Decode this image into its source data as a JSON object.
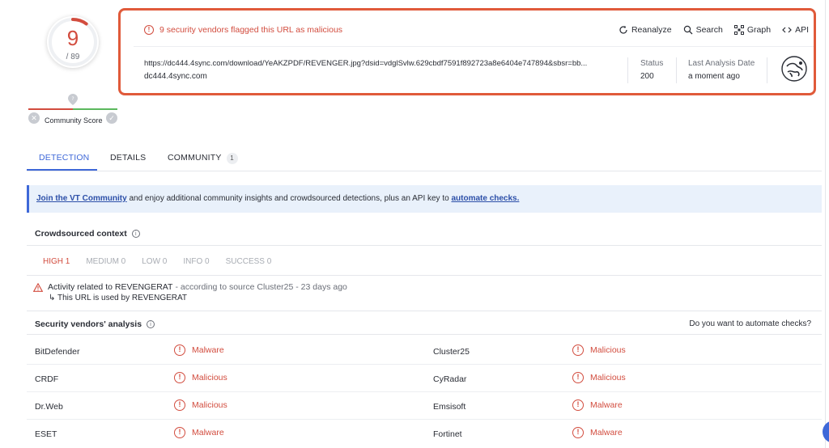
{
  "score": {
    "detections": "9",
    "total": "/ 89",
    "ring_color": "#d24c3e",
    "fraction": 0.101
  },
  "community_score": {
    "label": "Community Score",
    "x_icon": "x-icon",
    "check_icon": "check-icon",
    "pin_icon": "location-pin-icon"
  },
  "header": {
    "flag_text": "9 security vendors flagged this URL as malicious",
    "actions": [
      {
        "label": "Reanalyze",
        "icon": "refresh-icon"
      },
      {
        "label": "Search",
        "icon": "search-icon"
      },
      {
        "label": "Graph",
        "icon": "graph-icon"
      },
      {
        "label": "API",
        "icon": "code-icon"
      }
    ],
    "url": "https://dc444.4sync.com/download/YeAKZPDF/REVENGER.jpg?dsid=vdglSvlw.629cbdf7591f892723a8e6404e747894&sbsr=bb...",
    "domain": "dc444.4sync.com",
    "status_label": "Status",
    "status_value": "200",
    "last_label": "Last Analysis Date",
    "last_value": "a moment ago",
    "highlight_color": "#e05a3a"
  },
  "tabs": [
    {
      "label": "DETECTION",
      "active": true
    },
    {
      "label": "DETAILS",
      "active": false
    },
    {
      "label": "COMMUNITY",
      "badge": "1",
      "active": false
    }
  ],
  "banner": {
    "link1": "Join the VT Community",
    "middle": " and enjoy additional community insights and crowdsourced detections, plus an API key to ",
    "link2": "automate checks."
  },
  "crowdsourced": {
    "title": "Crowdsourced context",
    "severity_tabs": [
      "HIGH 1",
      "MEDIUM 0",
      "LOW 0",
      "INFO 0",
      "SUCCESS 0"
    ],
    "activity_title": "Activity related to REVENGERAT",
    "activity_source": "- according to source Cluster25 - 23 days ago",
    "activity_sub": "↳ This URL is used by REVENGERAT"
  },
  "vendors": {
    "title": "Security vendors' analysis",
    "automate_question": "Do you want to automate checks?",
    "rows": [
      {
        "left_name": "BitDefender",
        "left_verdict": "Malware",
        "right_name": "Cluster25",
        "right_verdict": "Malicious"
      },
      {
        "left_name": "CRDF",
        "left_verdict": "Malicious",
        "right_name": "CyRadar",
        "right_verdict": "Malicious"
      },
      {
        "left_name": "Dr.Web",
        "left_verdict": "Malicious",
        "right_name": "Emsisoft",
        "right_verdict": "Malware"
      },
      {
        "left_name": "ESET",
        "left_verdict": "Malware",
        "right_name": "Fortinet",
        "right_verdict": "Malware"
      }
    ]
  }
}
